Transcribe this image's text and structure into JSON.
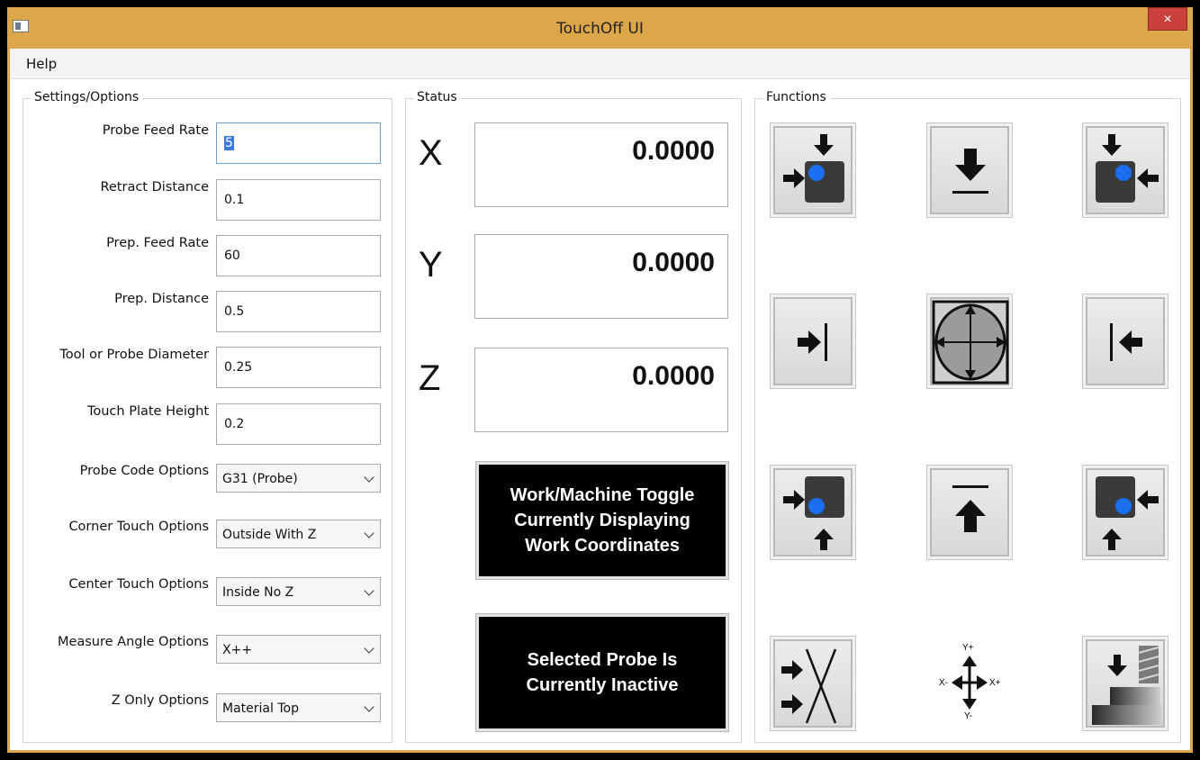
{
  "window": {
    "title": "TouchOff UI",
    "close_label": "×"
  },
  "menu": {
    "help": "Help"
  },
  "settings": {
    "title": "Settings/Options",
    "probe_feed_rate": {
      "label": "Probe Feed Rate",
      "value": "5"
    },
    "retract_distance": {
      "label": "Retract Distance",
      "value": "0.1"
    },
    "prep_feed_rate": {
      "label": "Prep. Feed Rate",
      "value": "60"
    },
    "prep_distance": {
      "label": "Prep. Distance",
      "value": "0.5"
    },
    "tool_diameter": {
      "label": "Tool or Probe Diameter",
      "value": "0.25"
    },
    "touch_plate_height": {
      "label": "Touch Plate Height",
      "value": "0.2"
    },
    "probe_code": {
      "label": "Probe Code Options",
      "value": "G31 (Probe)"
    },
    "corner_touch": {
      "label": "Corner Touch Options",
      "value": "Outside With Z"
    },
    "center_touch": {
      "label": "Center Touch Options",
      "value": "Inside No Z"
    },
    "measure_angle": {
      "label": "Measure Angle Options",
      "value": "X++"
    },
    "z_only": {
      "label": "Z Only Options",
      "value": "Material Top"
    }
  },
  "status": {
    "title": "Status",
    "x": {
      "label": "X",
      "value": "0.0000"
    },
    "y": {
      "label": "Y",
      "value": "0.0000"
    },
    "z": {
      "label": "Z",
      "value": "0.0000"
    },
    "toggle": {
      "line1": "Work/Machine Toggle",
      "line2": "Currently Displaying",
      "line3": "Work Coordinates"
    },
    "probe_state": {
      "line1": "Selected Probe Is",
      "line2": "Currently Inactive"
    }
  },
  "functions": {
    "title": "Functions",
    "axis_icon": {
      "y_plus": "Y+",
      "y_minus": "Y-",
      "x_plus": "X+",
      "x_minus": "X-"
    }
  },
  "colors": {
    "accent_blue": "#1a6ff0",
    "titlebar": "#dca64a",
    "close": "#c9413a"
  }
}
